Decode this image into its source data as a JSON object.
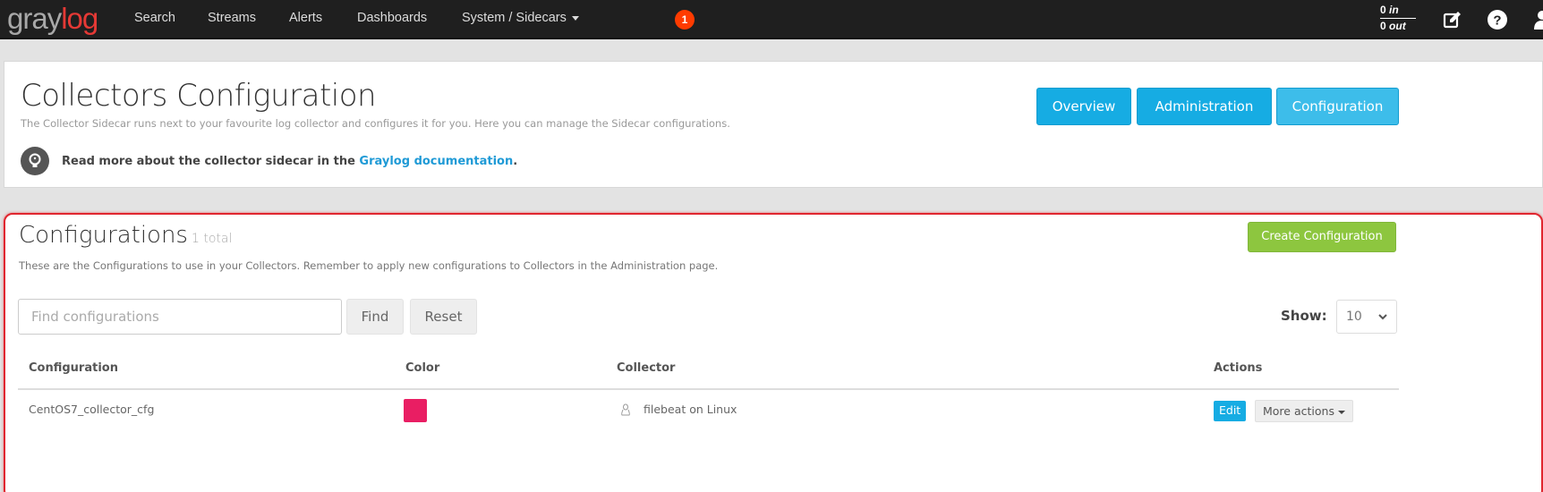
{
  "navbar": {
    "logo_left": "gray",
    "logo_right": "log",
    "items": [
      {
        "label": "Search"
      },
      {
        "label": "Streams"
      },
      {
        "label": "Alerts"
      },
      {
        "label": "Dashboards"
      },
      {
        "label": "System / Sidecars"
      }
    ],
    "notification_count": "1",
    "throughput": {
      "in_value": "0",
      "in_label": "in",
      "out_value": "0",
      "out_label": "out"
    },
    "icons": [
      "edit-icon",
      "help-icon",
      "user-icon"
    ]
  },
  "header": {
    "title": "Collectors Configuration",
    "description": "The Collector Sidecar runs next to your favourite log collector and configures it for you. Here you can manage the Sidecar configurations.",
    "doc_text": "Read more about the collector sidecar in the ",
    "doc_link": "Graylog documentation",
    "doc_suffix": ".",
    "buttons": [
      {
        "label": "Overview"
      },
      {
        "label": "Administration"
      },
      {
        "label": "Configuration",
        "active": true
      }
    ]
  },
  "configurations": {
    "title": "Configurations",
    "total": "1 total",
    "description": "These are the Configurations to use in your Collectors. Remember to apply new configurations to Collectors in the Administration page.",
    "create_button": "Create Configuration",
    "search": {
      "placeholder": "Find configurations",
      "value": ""
    },
    "find_button": "Find",
    "reset_button": "Reset",
    "show_label": "Show:",
    "page_size": "10",
    "columns": [
      "Configuration",
      "Color",
      "Collector",
      "Actions"
    ],
    "rows": [
      {
        "name": "CentOS7_collector_cfg",
        "color": "#e91e63",
        "collector": "filebeat on Linux",
        "collector_os_icon": "linux-icon",
        "edit_label": "Edit",
        "more_label": "More actions"
      }
    ]
  },
  "colors": {
    "navbar": "#1f1f1f",
    "brand_red": "#e53935",
    "info": "#16ace3",
    "success": "#8dc63f",
    "highlight_border": "#e0262f"
  }
}
